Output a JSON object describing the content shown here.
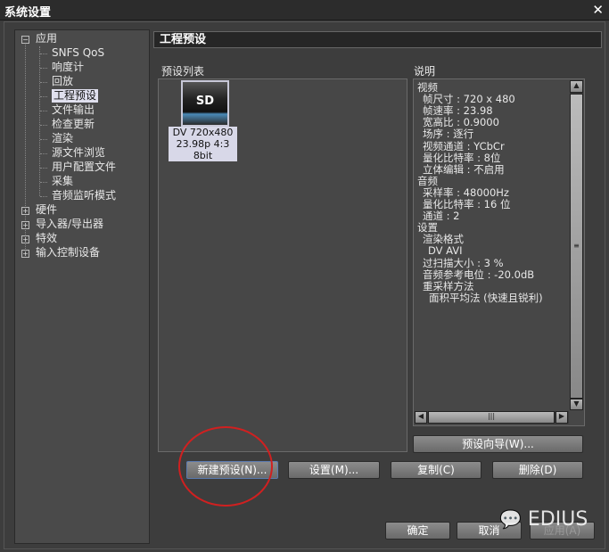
{
  "window": {
    "title": "系统设置",
    "close": "✕"
  },
  "tree": {
    "root": {
      "label": "应用",
      "toggle": "−"
    },
    "children": [
      "SNFS QoS",
      "响度计",
      "回放",
      "工程预设",
      "文件输出",
      "检查更新",
      "渲染",
      "源文件浏览",
      "用户配置文件",
      "采集",
      "音频监听模式"
    ],
    "selected": "工程预设",
    "others": [
      {
        "label": "硬件",
        "toggle": "+"
      },
      {
        "label": "导入器/导出器",
        "toggle": "+"
      },
      {
        "label": "特效",
        "toggle": "+"
      },
      {
        "label": "输入控制设备",
        "toggle": "+"
      }
    ]
  },
  "panel": {
    "title": "工程预设",
    "preset_list_label": "预设列表",
    "description_label": "说明"
  },
  "preset": {
    "badge": "SD",
    "line1": "DV 720x480",
    "line2": "23.98p 4:3 8bit"
  },
  "description": [
    "视频",
    "帧尺寸 : 720 x 480",
    "帧速率 : 23.98",
    "宽高比 : 0.9000",
    "场序 : 逐行",
    "视频通道 : YCbCr",
    "量化比特率 : 8位",
    "立体编辑 : 不启用",
    "音频",
    "采样率 : 48000Hz",
    "量化比特率 : 16 位",
    "通道 : 2",
    "设置",
    "渲染格式",
    "DV AVI",
    "过扫描大小 : 3 %",
    "音频参考电位 : -20.0dB",
    "重采样方法",
    "面积平均法 (快速且锐利)"
  ],
  "buttons": {
    "wizard": "预设向导(W)...",
    "new": "新建预设(N)...",
    "settings": "设置(M)...",
    "copy": "复制(C)",
    "delete": "删除(D)",
    "ok": "确定",
    "cancel": "取消",
    "apply": "应用(A)"
  },
  "watermark": "EDIUS"
}
